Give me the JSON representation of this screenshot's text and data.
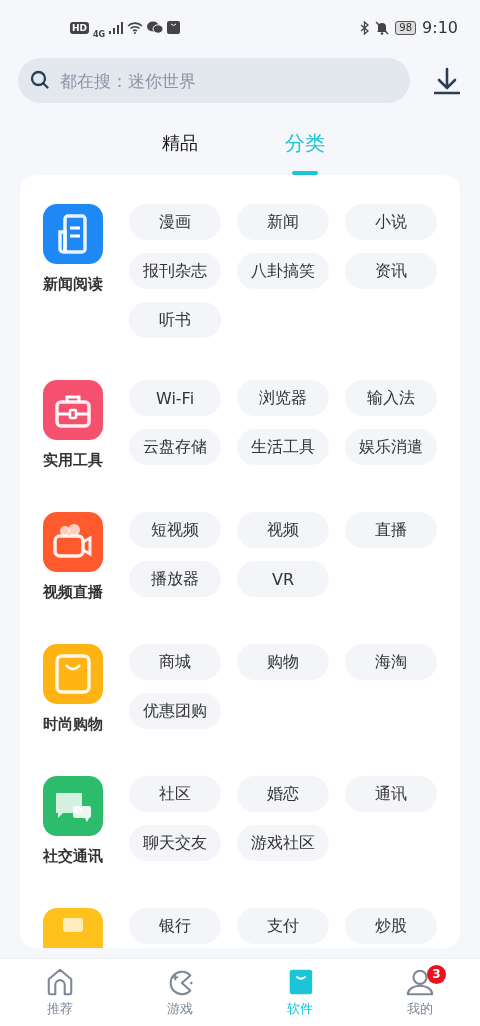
{
  "status_bar": {
    "hd": "HD",
    "network": "4G",
    "battery": "98",
    "time": "9:10"
  },
  "search": {
    "placeholder": "都在搜：迷你世界"
  },
  "tabs": [
    {
      "label": "精品",
      "selected": false
    },
    {
      "label": "分类",
      "selected": true
    }
  ],
  "categories": [
    {
      "kind": "news",
      "color": "#1e88f5",
      "name": "新闻阅读",
      "tags": [
        "漫画",
        "新闻",
        "小说",
        "报刊杂志",
        "八卦搞笑",
        "资讯",
        "听书"
      ]
    },
    {
      "kind": "tools",
      "color": "#f5506e",
      "name": "实用工具",
      "tags": [
        "Wi-Fi",
        "浏览器",
        "输入法",
        "云盘存储",
        "生活工具",
        "娱乐消遣"
      ]
    },
    {
      "kind": "video",
      "color": "#ff5a2e",
      "name": "视频直播",
      "tags": [
        "短视频",
        "视频",
        "直播",
        "播放器",
        "VR"
      ]
    },
    {
      "kind": "shopping",
      "color": "#ffb414",
      "name": "时尚购物",
      "tags": [
        "商城",
        "购物",
        "海淘",
        "优惠团购"
      ]
    },
    {
      "kind": "social",
      "color": "#2dbb6c",
      "name": "社交通讯",
      "tags": [
        "社区",
        "婚恋",
        "通讯",
        "聊天交友",
        "游戏社区"
      ]
    },
    {
      "kind": "finance",
      "color": "#ffc21c",
      "tags": [
        "银行",
        "支付",
        "炒股"
      ]
    }
  ],
  "bottom_nav": [
    {
      "kind": "home",
      "label": "推荐",
      "selected": false
    },
    {
      "kind": "game",
      "label": "游戏",
      "selected": false
    },
    {
      "kind": "apps",
      "label": "软件",
      "selected": true
    },
    {
      "kind": "profile",
      "label": "我的",
      "selected": false,
      "badge": "3"
    }
  ]
}
